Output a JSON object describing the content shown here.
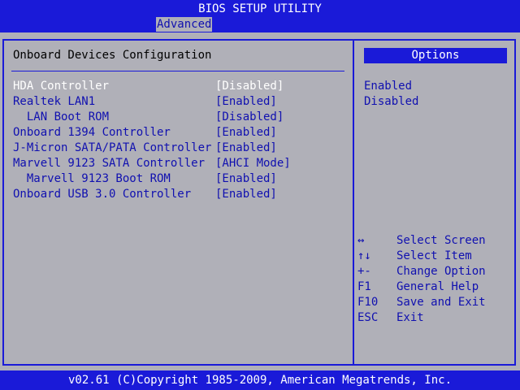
{
  "header": {
    "title": "BIOS SETUP UTILITY",
    "active_tab": "Advanced"
  },
  "main": {
    "page_title": "Onboard Devices Configuration",
    "settings": [
      {
        "label": "HDA Controller",
        "value": "[Disabled]",
        "selected": true
      },
      {
        "label": "Realtek LAN1",
        "value": "[Enabled]"
      },
      {
        "label": "  LAN Boot ROM",
        "value": "[Disabled]"
      },
      {
        "label": "Onboard 1394 Controller",
        "value": "[Enabled]"
      },
      {
        "label": "J-Micron SATA/PATA Controller",
        "value": "[Enabled]"
      },
      {
        "label": "Marvell 9123 SATA Controller",
        "value": "[AHCI Mode]"
      },
      {
        "label": "  Marvell 9123 Boot ROM",
        "value": "[Enabled]"
      },
      {
        "label": "Onboard USB 3.0 Controller",
        "value": "[Enabled]"
      }
    ]
  },
  "sidebar": {
    "options_title": "Options",
    "options": [
      "Enabled",
      "Disabled"
    ],
    "help": [
      {
        "key": "↔",
        "key_icon": "left-right-arrow-icon",
        "desc": "Select Screen"
      },
      {
        "key": "↑↓",
        "key_icon": "up-down-arrow-icon",
        "desc": "Select Item"
      },
      {
        "key": "+-",
        "desc": "Change Option"
      },
      {
        "key": "F1",
        "desc": "General Help"
      },
      {
        "key": "F10",
        "desc": "Save and Exit"
      },
      {
        "key": "ESC",
        "desc": "Exit"
      }
    ]
  },
  "footer": {
    "copyright": "v02.61 (C)Copyright 1985-2009, American Megatrends, Inc."
  },
  "colors": {
    "bar_blue": "#1a1ad8",
    "background_gray": "#b0b0b8",
    "text_blue": "#1010b0",
    "selected_text": "#ffffff"
  }
}
